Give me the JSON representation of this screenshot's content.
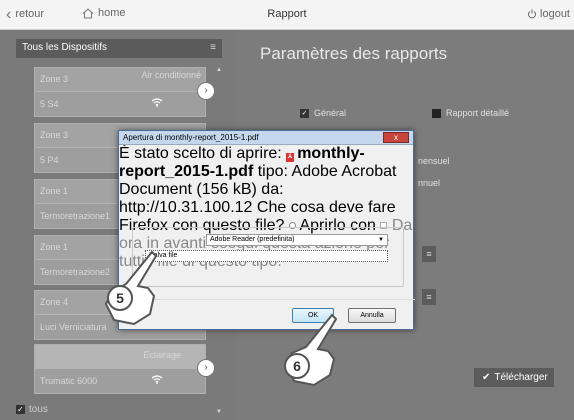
{
  "topbar": {
    "back_label": "retour",
    "home_label": "home",
    "title": "Rapport",
    "logout_label": "logout"
  },
  "left": {
    "header": "Tous les Dispositifs",
    "zones": [
      {
        "name": "Zone 3",
        "type": "Air conditionné",
        "sub": "5 S4",
        "wifi": true,
        "arrow": true
      },
      {
        "name": "Zone 3",
        "type": "",
        "sub": "5 P4",
        "wifi": false,
        "arrow": false
      },
      {
        "name": "Zone 1",
        "type": "",
        "sub": "Termoretrazione1",
        "wifi": false,
        "arrow": false
      },
      {
        "name": "Zone 1",
        "type": "",
        "sub": "Termoretrazione2",
        "wifi": false,
        "arrow": false
      },
      {
        "name": "Zone 4",
        "type": "",
        "sub": "Luci Verniciatura",
        "wifi": false,
        "arrow": false
      },
      {
        "name": "",
        "type": "Eclairage",
        "sub": "Trumatic 6000",
        "wifi": true,
        "arrow": true
      }
    ],
    "tous_label": "tous"
  },
  "right": {
    "title": "Paramètres des rapports",
    "general_label": "Général",
    "detail_label": "Rapport détaillé",
    "mensuel_label": "nensuel",
    "annuel_label": "nnuel",
    "download_label": "Télécharger"
  },
  "dialog": {
    "title": "Apertura di monthly-report_2015-1.pdf",
    "close_label": "x",
    "intro": "È stato scelto di aprire:",
    "filename": "monthly-report_2015-1.pdf",
    "type_line": "tipo: Adobe Acrobat Document (156 kB)",
    "from_line": "da: http://10.31.100.12",
    "question": "Che cosa deve fare Firefox con questo file?",
    "open_with_label": "Aprirlo con",
    "open_with_value": "Adobe Reader  (predefinita)",
    "save_label": "Salva file",
    "remember_label": "Da ora in avanti esegui questa azione per tutti i file di questo tipo.",
    "ok_label": "OK",
    "cancel_label": "Annulla"
  },
  "steps": {
    "step5": "5",
    "step6": "6"
  },
  "colors": {
    "background": "#7c7c7c",
    "dialog_border": "#4a6b95",
    "close_button": "#c9453b"
  }
}
